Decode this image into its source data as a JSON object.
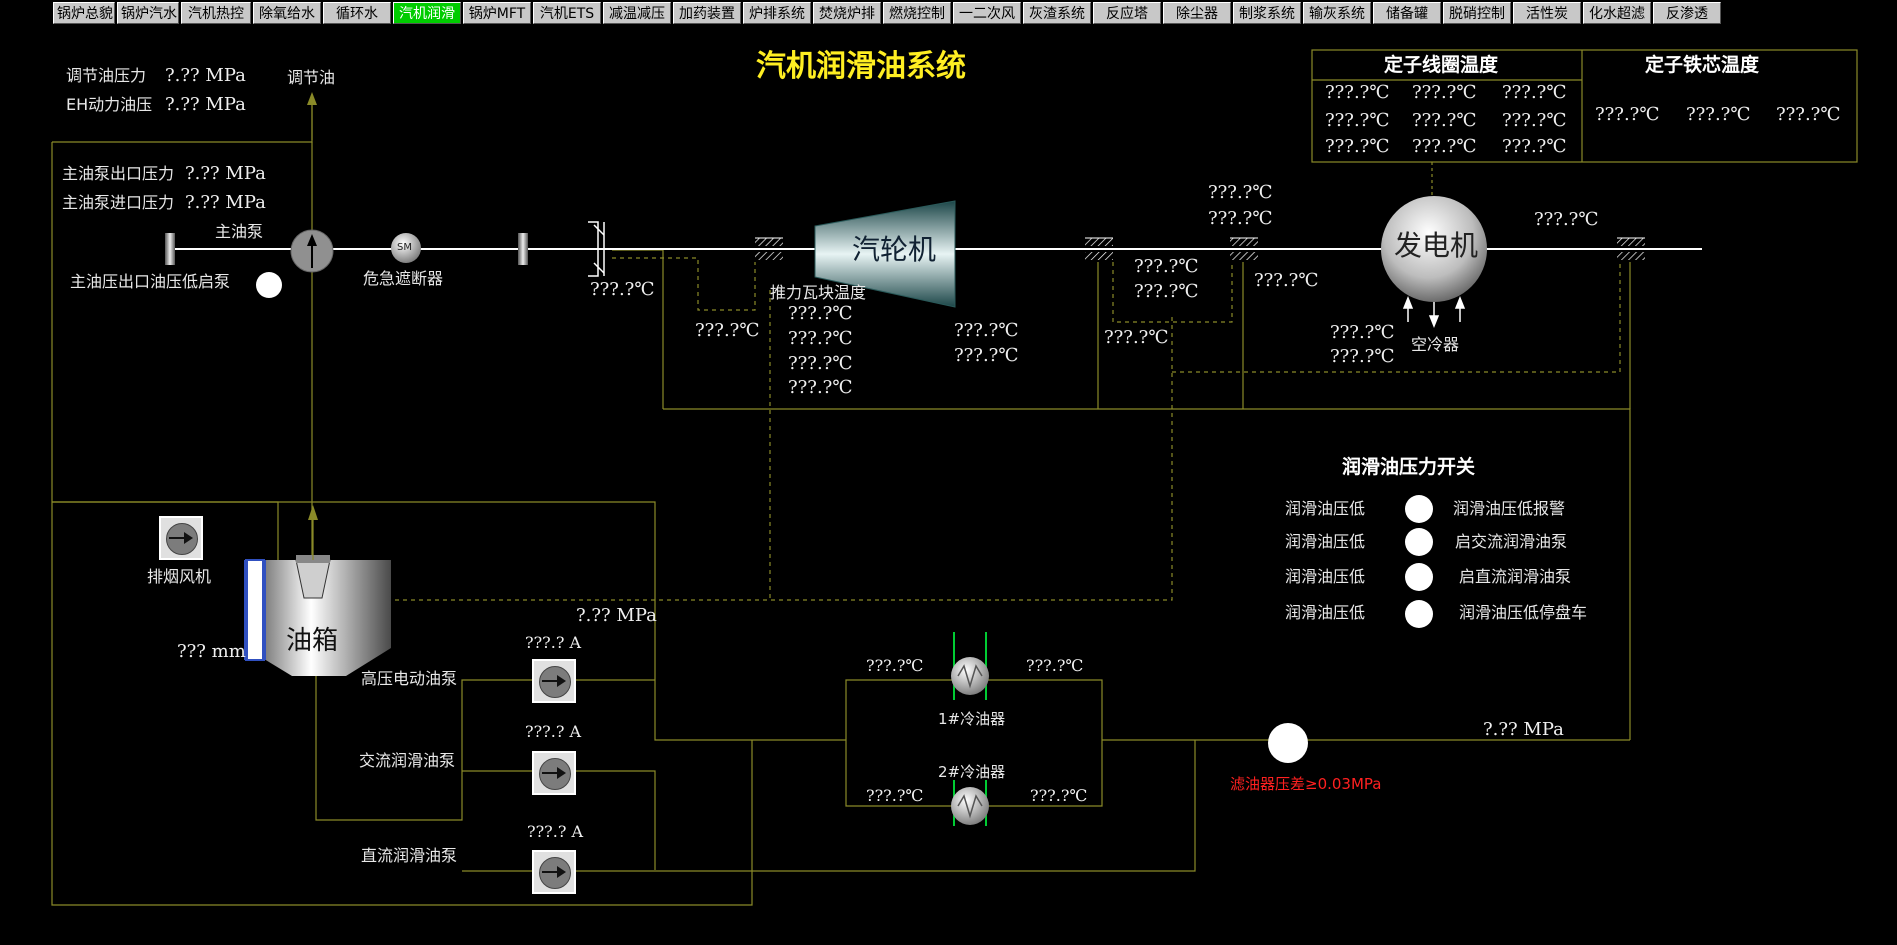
{
  "tabs": [
    {
      "label": "锅炉总貌",
      "active": false
    },
    {
      "label": "锅炉汽水",
      "active": false
    },
    {
      "label": "汽机热控",
      "active": false
    },
    {
      "label": "除氧给水",
      "active": false
    },
    {
      "label": "循环水",
      "active": false
    },
    {
      "label": "汽机润滑",
      "active": true
    },
    {
      "label": "锅炉MFT",
      "active": false
    },
    {
      "label": "汽机ETS",
      "active": false
    },
    {
      "label": "减温减压",
      "active": false
    },
    {
      "label": "加药装置",
      "active": false
    },
    {
      "label": "炉排系统",
      "active": false
    },
    {
      "label": "焚烧炉排",
      "active": false
    },
    {
      "label": "燃烧控制",
      "active": false
    },
    {
      "label": "一二次风",
      "active": false
    },
    {
      "label": "灰渣系统",
      "active": false
    },
    {
      "label": "反应塔",
      "active": false
    },
    {
      "label": "除尘器",
      "active": false
    },
    {
      "label": "制浆系统",
      "active": false
    },
    {
      "label": "输灰系统",
      "active": false
    },
    {
      "label": "储备罐",
      "active": false
    },
    {
      "label": "脱硝控制",
      "active": false
    },
    {
      "label": "活性炭",
      "active": false
    },
    {
      "label": "化水超滤",
      "active": false
    },
    {
      "label": "反渗透",
      "active": false
    }
  ],
  "title": "汽机润滑油系统",
  "top_left": {
    "reg_oil_pressure_label": "调节油压力",
    "reg_oil_pressure_value": "?.?? MPa",
    "eh_pressure_label": "EH动力油压",
    "eh_pressure_value": "?.?? MPa",
    "reg_oil_label": "调节油",
    "main_pump_out_label": "主油泵出口压力",
    "main_pump_out_value": "?.?? MPa",
    "main_pump_in_label": "主油泵进口压力",
    "main_pump_in_value": "?.?? MPa",
    "main_pump_label": "主油泵",
    "low_start_label": "主油压出口油压低启泵",
    "sm_label": "SM",
    "emergency_trip_label": "危急遮断器"
  },
  "stator_panel": {
    "coil_header": "定子线圈温度",
    "core_header": "定子铁芯温度",
    "coil_values": [
      "???.?℃",
      "???.?℃",
      "???.?℃",
      "???.?℃",
      "???.?℃",
      "???.?℃",
      "???.?℃",
      "???.?℃",
      "???.?℃"
    ],
    "core_values": [
      "???.?℃",
      "???.?℃",
      "???.?℃"
    ]
  },
  "shaft": {
    "turbine_label": "汽轮机",
    "generator_label": "发电机",
    "thrust_label": "推力瓦块温度",
    "bearing1_temp": "???.?℃",
    "bearing1_drain_temp": "???.?℃",
    "thrust_temps": [
      "???.?℃",
      "???.?℃",
      "???.?℃",
      "???.?℃"
    ],
    "bearing2_temps": [
      "???.?℃",
      "???.?℃"
    ],
    "bearing3_temps": [
      "???.?℃",
      "???.?℃"
    ],
    "bearing3_drain_temp": "???.?℃",
    "bearing4_top_temps": [
      "???.?℃",
      "???.?℃"
    ],
    "bearing4_temp": "???.?℃",
    "air_cooler_temps": [
      "???.?℃",
      "???.?℃"
    ],
    "air_cooler_label": "空冷器",
    "bearing5_temp": "???.?℃"
  },
  "tank": {
    "fan_label": "排烟风机",
    "tank_label": "油箱",
    "level": "??? mm",
    "pressure": "?.?? MPa"
  },
  "pumps": [
    {
      "label": "高压电动油泵",
      "current": "???.? A"
    },
    {
      "label": "交流润滑油泵",
      "current": "???.? A"
    },
    {
      "label": "直流润滑油泵",
      "current": "???.? A"
    }
  ],
  "coolers": {
    "cooler1_label": "1#冷油器",
    "cooler2_label": "2#冷油器",
    "cooler1_in": "???.?℃",
    "cooler1_out": "???.?℃",
    "cooler2_in": "???.?℃",
    "cooler2_out": "???.?℃"
  },
  "filter": {
    "warning": "滤油器压差≥0.03MPa",
    "pressure": "?.?? MPa"
  },
  "pressure_switch": {
    "header": "润滑油压力开关",
    "rows": [
      {
        "left": "润滑油压低",
        "right": "润滑油压低报警"
      },
      {
        "left": "润滑油压低",
        "right": "启交流润滑油泵"
      },
      {
        "left": "润滑油压低",
        "right": "启直流润滑油泵"
      },
      {
        "left": "润滑油压低",
        "right": "润滑油压低停盘车"
      }
    ]
  },
  "colors": {
    "pipe": "#8a8a28",
    "active_tab": "#00cc00",
    "title": "#ffee22",
    "warning": "#ff2020"
  }
}
